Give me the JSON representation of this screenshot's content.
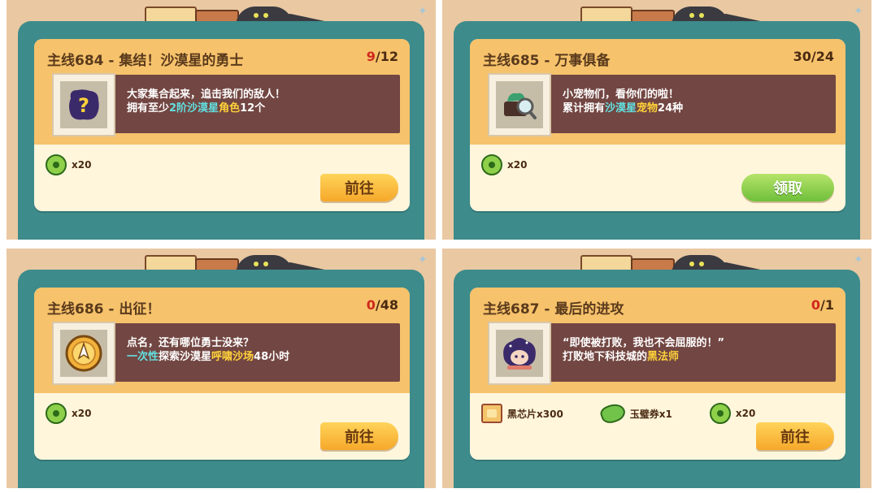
{
  "reward_disc_icon": "green-disc-icon",
  "quests": [
    {
      "title": "主线684 - 集结！沙漠星的勇士",
      "progress_current": "9",
      "progress_total": "/12",
      "completed": false,
      "icon": "question-mark-icon",
      "desc_line1": "大家集合起来，追击我们的敌人！",
      "desc_line2_parts": [
        "拥有至少",
        "2阶沙漠星",
        "角色",
        "12个"
      ],
      "rewards": [
        {
          "icon": "green-disc-icon",
          "label": "x20"
        }
      ],
      "button_label": "前往",
      "button_kind": "go"
    },
    {
      "title": "主线685 - 万事俱备",
      "progress_current": "30",
      "progress_total": "/24",
      "completed": true,
      "icon": "pet-magnifier-icon",
      "desc_line1": "小宠物们，看你们的啦！",
      "desc_line2_parts": [
        "累计拥有",
        "沙漠星",
        "宠物",
        "24种"
      ],
      "rewards": [
        {
          "icon": "green-disc-icon",
          "label": "x20"
        }
      ],
      "button_label": "领取",
      "button_kind": "claim"
    },
    {
      "title": "主线686 - 出征！",
      "progress_current": "0",
      "progress_total": "/48",
      "completed": false,
      "icon": "compass-clock-icon",
      "desc_line1": "点名，还有哪位勇士没来？",
      "desc_line2_parts": [
        "一次性",
        "探索沙漠星",
        "呼啸沙场",
        "48小时"
      ],
      "rewards": [
        {
          "icon": "green-disc-icon",
          "label": "x20"
        }
      ],
      "button_label": "前往",
      "button_kind": "go"
    },
    {
      "title": "主线687 - 最后的进攻",
      "progress_current": "0",
      "progress_total": "/1",
      "completed": false,
      "icon": "dark-mage-icon",
      "desc_line1": "“即使被打败，我也不会屈服的！”",
      "desc_line2_parts": [
        "打败地下科技城的",
        "黑法师",
        "",
        ""
      ],
      "rewards": [
        {
          "icon": "black-chip-icon",
          "label": "黑芯片x300"
        },
        {
          "icon": "jade-coupon-icon",
          "label": "玉璧券x1"
        },
        {
          "icon": "green-disc-icon",
          "label": "x20"
        }
      ],
      "button_label": "前往",
      "button_kind": "go"
    }
  ],
  "colors": {
    "panel_bg": "#e9c8a2",
    "frame_teal": "#3d8b8b",
    "card_header": "#f6c26b",
    "card_body": "#fff6dc",
    "desc_bg": "#724642",
    "highlight_cyan": "#62e0e0",
    "highlight_yellow": "#ffd23a",
    "progress_red": "#d0281e",
    "go_button": "#f6a82a",
    "claim_button": "#6fbf3a"
  }
}
